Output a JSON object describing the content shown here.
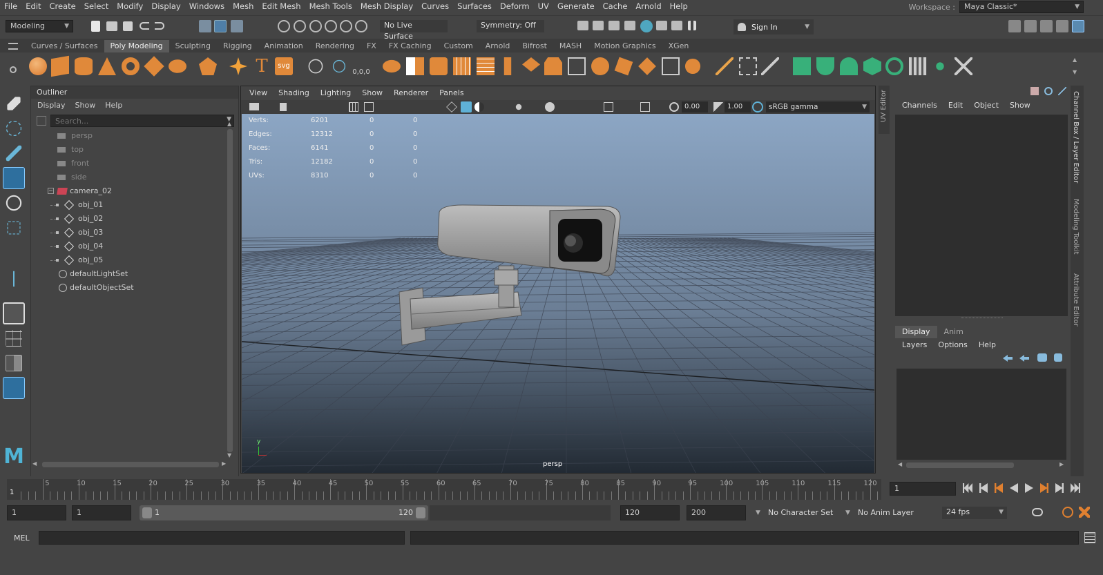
{
  "menu": [
    "File",
    "Edit",
    "Create",
    "Select",
    "Modify",
    "Display",
    "Windows",
    "Mesh",
    "Edit Mesh",
    "Mesh Tools",
    "Mesh Display",
    "Curves",
    "Surfaces",
    "Deform",
    "UV",
    "Generate",
    "Cache",
    "Arnold",
    "Help"
  ],
  "workspace": {
    "label": "Workspace :",
    "value": "Maya Classic*"
  },
  "statusline": {
    "mode": "Modeling",
    "live_surface": "No Live Surface",
    "symmetry": "Symmetry: Off",
    "sign_in": "Sign In"
  },
  "shelf_tabs": [
    "Curves / Surfaces",
    "Poly Modeling",
    "Sculpting",
    "Rigging",
    "Animation",
    "Rendering",
    "FX",
    "FX Caching",
    "Custom",
    "Arnold",
    "Bifrost",
    "MASH",
    "Motion Graphics",
    "XGen"
  ],
  "shelf_active": "Poly Modeling",
  "shelf_svg_label": "svg",
  "outliner": {
    "title": "Outliner",
    "menu": [
      "Display",
      "Show",
      "Help"
    ],
    "search_placeholder": "Search...",
    "items": [
      {
        "label": "persp",
        "dim": true,
        "indent": 1
      },
      {
        "label": "top",
        "dim": true,
        "indent": 1
      },
      {
        "label": "front",
        "dim": true,
        "indent": 1
      },
      {
        "label": "side",
        "dim": true,
        "indent": 1
      },
      {
        "label": "camera_02",
        "dim": false,
        "indent": 0
      },
      {
        "label": "obj_01",
        "dim": false,
        "indent": 2
      },
      {
        "label": "obj_02",
        "dim": false,
        "indent": 2
      },
      {
        "label": "obj_03",
        "dim": false,
        "indent": 2
      },
      {
        "label": "obj_04",
        "dim": false,
        "indent": 2
      },
      {
        "label": "obj_05",
        "dim": false,
        "indent": 2
      },
      {
        "label": "defaultLightSet",
        "dim": false,
        "indent": 1
      },
      {
        "label": "defaultObjectSet",
        "dim": false,
        "indent": 1
      }
    ]
  },
  "viewport": {
    "menu": [
      "View",
      "Shading",
      "Lighting",
      "Show",
      "Renderer",
      "Panels"
    ],
    "exposure": "0.00",
    "gamma": "1.00",
    "colorspace": "sRGB gamma",
    "camera": "persp",
    "axis_y": "y",
    "hud": [
      {
        "label": "Verts:",
        "a": "6201",
        "b": "0",
        "c": "0"
      },
      {
        "label": "Edges:",
        "a": "12312",
        "b": "0",
        "c": "0"
      },
      {
        "label": "Faces:",
        "a": "6141",
        "b": "0",
        "c": "0"
      },
      {
        "label": "Tris:",
        "a": "12182",
        "b": "0",
        "c": "0"
      },
      {
        "label": "UVs:",
        "a": "8310",
        "b": "0",
        "c": "0"
      }
    ]
  },
  "channelbox": {
    "menu": [
      "Channels",
      "Edit",
      "Object",
      "Show"
    ],
    "layer_tabs": [
      "Display",
      "Anim"
    ],
    "layer_menu": [
      "Layers",
      "Options",
      "Help"
    ]
  },
  "side_tabs": [
    "Channel Box / Layer Editor",
    "Modeling Toolkit",
    "Attribute Editor"
  ],
  "uv_editor_tab": "UV Editor",
  "timeline": {
    "ticks": [
      "5",
      "10",
      "15",
      "20",
      "25",
      "30",
      "35",
      "40",
      "45",
      "50",
      "55",
      "60",
      "65",
      "70",
      "75",
      "80",
      "85",
      "90",
      "95",
      "100",
      "105",
      "110",
      "115",
      "120"
    ],
    "current_frame_marker": "1",
    "current_frame": "1"
  },
  "range": {
    "start": "1",
    "anim_start": "1",
    "slider_start": "1",
    "slider_end": "120",
    "end": "120",
    "anim_end": "200",
    "character": "No Character Set",
    "anim_layer": "No Anim Layer",
    "fps": "24 fps"
  },
  "cmd": {
    "label": "MEL"
  }
}
